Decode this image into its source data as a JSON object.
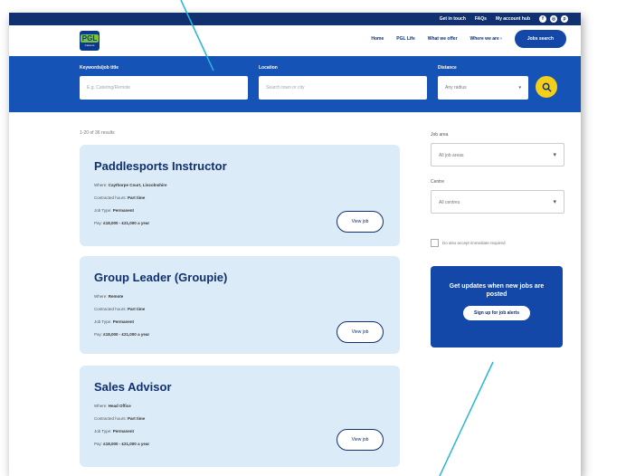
{
  "topbar": {
    "get_in_touch": "Get in touch",
    "faqs": "FAQs",
    "my_account": "My account hub",
    "social_icons": [
      "facebook-icon",
      "instagram-icon",
      "pinterest-icon"
    ]
  },
  "header": {
    "logo_text": "PGL",
    "logo_sub": "Careers",
    "nav": [
      "Home",
      "PGL Life",
      "What we offer",
      "Where we are ›"
    ],
    "cta": "Jobs search"
  },
  "search": {
    "keywords_label": "Keywords/job title",
    "keywords_placeholder": "E.g. Catering/Remote",
    "location_label": "Location",
    "location_placeholder": "Search town or city",
    "distance_label": "Distance",
    "distance_value": "Any radius",
    "button_icon": "search-icon"
  },
  "results": {
    "count_text": "1-20 of 36 results"
  },
  "jobs": [
    {
      "title": "Paddlesports Instructor",
      "where": "Caythorpe Court, Lincolnshire",
      "hours": "Part time",
      "type": "Permanent",
      "pay": "£18,000 - £21,000 a year",
      "button": "View job"
    },
    {
      "title": "Group Leader (Groupie)",
      "where": "Remote",
      "hours": "Part time",
      "type": "Permanent",
      "pay": "£18,000 - £21,000 a year",
      "button": "View job"
    },
    {
      "title": "Sales Advisor",
      "where": "Head Office",
      "hours": "Part time",
      "type": "Permanent",
      "pay": "£18,000 - £21,000 a year",
      "button": "View job"
    }
  ],
  "job_labels": {
    "where": "Where:",
    "hours": "Contracted hours:",
    "type": "Job Type:",
    "pay": "Pay:"
  },
  "filters": {
    "job_area_label": "Job area",
    "job_area_value": "All job areas",
    "centre_label": "Centre",
    "centre_value": "All centres",
    "checkbox_label": "Do also accept immediate required"
  },
  "promo": {
    "text": "Get updates when new jobs are posted",
    "button": "Sign up for job alerts"
  },
  "colors": {
    "navy": "#10306f",
    "blue": "#1553b6",
    "card": "#dcebf8",
    "yellow": "#f3cf1a",
    "annotation": "#27b6d6"
  }
}
